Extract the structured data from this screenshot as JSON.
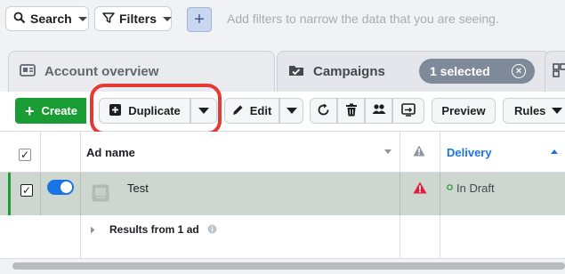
{
  "filter_bar": {
    "search_label": "Search",
    "filters_label": "Filters",
    "add_label": "+",
    "hint": "Add filters to narrow the data that you are seeing."
  },
  "tabs": {
    "account_overview": "Account overview",
    "campaigns": "Campaigns",
    "selected_badge": "1 selected",
    "clear_label": "×"
  },
  "toolbar": {
    "create_label": "Create",
    "duplicate_label": "Duplicate",
    "edit_label": "Edit",
    "preview_label": "Preview",
    "rules_label": "Rules"
  },
  "table": {
    "columns": [
      "Ad name",
      "Delivery"
    ],
    "rows": [
      {
        "name": "Test",
        "delivery": "In Draft",
        "selected": true,
        "on": true,
        "warning": true
      }
    ],
    "results_label": "Results from 1 ad"
  },
  "colors": {
    "create_green": "#1a9c35",
    "delivery_blue": "#1b74e4",
    "highlight_red": "#e53935",
    "warning_red": "#e41e3f"
  },
  "icons": [
    "search-icon",
    "filter-icon",
    "plus-icon",
    "account-overview-icon",
    "campaigns-icon",
    "duplicate-icon",
    "pencil-icon",
    "refresh-icon",
    "trash-icon",
    "ab-test-icon",
    "export-icon",
    "warning-icon",
    "info-icon",
    "chevron-right-icon"
  ]
}
